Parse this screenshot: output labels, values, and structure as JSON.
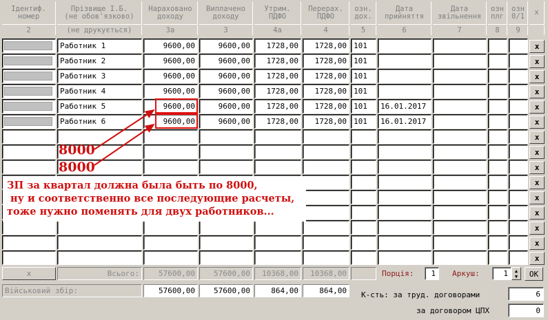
{
  "headers": [
    {
      "line1": "Ідентиф.",
      "line2": "номер",
      "sub": "2"
    },
    {
      "line1": "Прізвище І.Б.",
      "line2": "(не обов'язково)",
      "sub": "(не друкується)"
    },
    {
      "line1": "Нараховано",
      "line2": "доходу",
      "sub": "3а"
    },
    {
      "line1": "Виплачено",
      "line2": "доходу",
      "sub": "3"
    },
    {
      "line1": "Утрим.",
      "line2": "ПДФО",
      "sub": "4а"
    },
    {
      "line1": "Перерах.",
      "line2": "ПДФО",
      "sub": "4"
    },
    {
      "line1": "озн.",
      "line2": "дох.",
      "sub": "5"
    },
    {
      "line1": "Дата",
      "line2": "прийняття",
      "sub": "6"
    },
    {
      "line1": "Дата",
      "line2": "звільнення",
      "sub": "7"
    },
    {
      "line1": "озн",
      "line2": "плг",
      "sub": "8"
    },
    {
      "line1": "озн",
      "line2": "0/1",
      "sub": "9"
    },
    {
      "line1": "x",
      "line2": "",
      "sub": ""
    }
  ],
  "rows": [
    {
      "name": "Работник 1",
      "accrued": "9600,00",
      "paid": "9600,00",
      "withheld": "1728,00",
      "transferred": "1728,00",
      "code": "101",
      "hired": "",
      "fired": "",
      "x": "x"
    },
    {
      "name": "Работник 2",
      "accrued": "9600,00",
      "paid": "9600,00",
      "withheld": "1728,00",
      "transferred": "1728,00",
      "code": "101",
      "hired": "",
      "fired": "",
      "x": "x"
    },
    {
      "name": "Работник 3",
      "accrued": "9600,00",
      "paid": "9600,00",
      "withheld": "1728,00",
      "transferred": "1728,00",
      "code": "101",
      "hired": "",
      "fired": "",
      "x": "x"
    },
    {
      "name": "Работник 4",
      "accrued": "9600,00",
      "paid": "9600,00",
      "withheld": "1728,00",
      "transferred": "1728,00",
      "code": "101",
      "hired": "",
      "fired": "",
      "x": "x"
    },
    {
      "name": "Работник 5",
      "accrued": "9600,00",
      "paid": "9600,00",
      "withheld": "1728,00",
      "transferred": "1728,00",
      "code": "101",
      "hired": "16.01.2017",
      "fired": "",
      "x": "x"
    },
    {
      "name": "Работник 6",
      "accrued": "9600,00",
      "paid": "9600,00",
      "withheld": "1728,00",
      "transferred": "1728,00",
      "code": "101",
      "hired": "16.01.2017",
      "fired": "",
      "x": "x"
    }
  ],
  "empty_row_count": 9,
  "totals": {
    "x_label": "x",
    "label": "Всього:",
    "accrued": "57600,00",
    "paid": "57600,00",
    "withheld": "10368,00",
    "transferred": "10368,00"
  },
  "military": {
    "label": "Військовий збір:",
    "accrued": "57600,00",
    "paid": "57600,00",
    "withheld": "864,00",
    "transferred": "864,00"
  },
  "portion": {
    "label": "Порція:",
    "value": "1"
  },
  "sheet": {
    "label": "Аркуш:",
    "value": "1",
    "ok_label": "OK"
  },
  "counts": {
    "label_labor": "К-сть: за труд. договорами",
    "value_labor": "6",
    "label_gph": "за договором ЦПХ",
    "value_gph": "0"
  },
  "annotation": {
    "num1": "8000",
    "num2": "8000",
    "note_lines": [
      "ЗП за квартал должна была быть по 8000,",
      " ну и соответственно все последующие расчеты,",
      "тоже нужно поменять для двух работников..."
    ],
    "color": "#d01010"
  },
  "colors": {
    "background": "#d4d0c8",
    "annotation": "#d01010",
    "label_maroon": "#8b1a1a"
  }
}
